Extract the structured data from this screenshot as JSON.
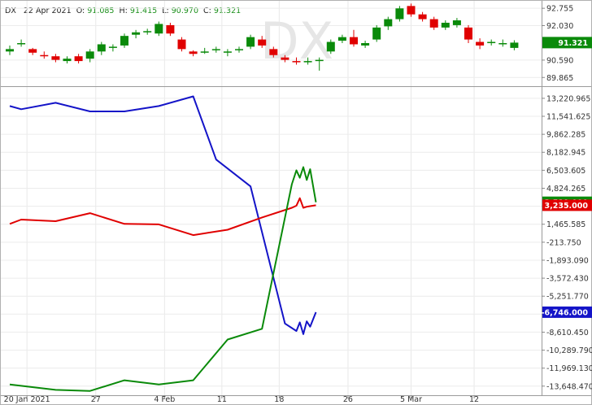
{
  "info": {
    "symbol": "DX",
    "date": "22 Apr 2021",
    "open_label": "O:",
    "open": "91.085",
    "high_label": "H:",
    "high": "91.415",
    "low_label": "L:",
    "low": "90.970",
    "close_label": "C:",
    "close": "91.321"
  },
  "watermark": "DX",
  "chart_data": [
    {
      "type": "candlestick",
      "title": "DX",
      "ylim": [
        89.5,
        93.1
      ],
      "y_ticks": [
        "92.755",
        "92.030",
        "90.590",
        "89.865"
      ],
      "last_value_label": "91.321",
      "colors": {
        "up": "#0a8a0a",
        "down": "#e00000",
        "last_badge": "#0a8a0a"
      },
      "candles": [
        [
          0,
          90.95,
          91.05,
          90.8,
          91.2
        ],
        [
          1,
          91.3,
          91.3,
          91.15,
          91.45
        ],
        [
          2,
          91.05,
          90.9,
          90.8,
          91.1
        ],
        [
          3,
          90.8,
          90.75,
          90.65,
          90.95
        ],
        [
          4,
          90.75,
          90.6,
          90.5,
          90.85
        ],
        [
          5,
          90.55,
          90.65,
          90.45,
          90.75
        ],
        [
          6,
          90.75,
          90.55,
          90.45,
          90.85
        ],
        [
          7,
          90.65,
          90.95,
          90.5,
          91.05
        ],
        [
          8,
          90.95,
          91.25,
          90.8,
          91.35
        ],
        [
          9,
          91.1,
          91.15,
          90.95,
          91.25
        ],
        [
          10,
          91.2,
          91.6,
          91.1,
          91.7
        ],
        [
          11,
          91.65,
          91.75,
          91.5,
          91.85
        ],
        [
          12,
          91.75,
          91.8,
          91.65,
          91.9
        ],
        [
          13,
          91.7,
          92.1,
          91.6,
          92.2
        ],
        [
          14,
          92.05,
          91.7,
          91.6,
          92.15
        ],
        [
          15,
          91.45,
          91.05,
          90.95,
          91.55
        ],
        [
          16,
          90.95,
          90.85,
          90.75,
          91.0
        ],
        [
          17,
          90.95,
          90.95,
          90.85,
          91.1
        ],
        [
          18,
          91.05,
          91.05,
          90.9,
          91.15
        ],
        [
          19,
          90.95,
          90.95,
          90.75,
          91.05
        ],
        [
          20,
          91.05,
          91.05,
          90.9,
          91.15
        ],
        [
          21,
          91.15,
          91.55,
          91.05,
          91.65
        ],
        [
          22,
          91.45,
          91.2,
          91.1,
          91.6
        ],
        [
          23,
          91.05,
          90.8,
          90.7,
          91.15
        ],
        [
          24,
          90.7,
          90.6,
          90.5,
          90.8
        ],
        [
          25,
          90.55,
          90.5,
          90.4,
          90.7
        ],
        [
          26,
          90.5,
          90.55,
          90.4,
          90.7
        ],
        [
          27,
          90.6,
          90.6,
          90.15,
          90.7
        ],
        [
          28,
          90.95,
          91.35,
          90.85,
          91.45
        ],
        [
          29,
          91.4,
          91.55,
          91.3,
          91.65
        ],
        [
          30,
          91.55,
          91.25,
          91.15,
          91.85
        ],
        [
          31,
          91.2,
          91.3,
          91.1,
          91.4
        ],
        [
          32,
          91.45,
          91.95,
          91.35,
          92.05
        ],
        [
          33,
          92.0,
          92.3,
          91.85,
          92.4
        ],
        [
          34,
          92.3,
          92.75,
          92.2,
          92.85
        ],
        [
          35,
          92.85,
          92.5,
          92.4,
          92.95
        ],
        [
          36,
          92.5,
          92.3,
          92.2,
          92.6
        ],
        [
          37,
          92.3,
          91.95,
          91.85,
          92.4
        ],
        [
          38,
          91.95,
          92.15,
          91.85,
          92.25
        ],
        [
          39,
          92.05,
          92.25,
          91.95,
          92.35
        ],
        [
          40,
          91.95,
          91.45,
          91.3,
          92.05
        ],
        [
          41,
          91.35,
          91.2,
          91.05,
          91.5
        ],
        [
          42,
          91.3,
          91.35,
          91.2,
          91.45
        ],
        [
          43,
          91.3,
          91.3,
          91.15,
          91.45
        ],
        [
          44,
          91.1,
          91.32,
          91.0,
          91.42
        ]
      ]
    },
    {
      "type": "line",
      "ylim": [
        -14500,
        14200
      ],
      "y_ticks": [
        "13,220.965",
        "11,541.625",
        "9,862.285",
        "8,182.945",
        "6,503.605",
        "4,824.265",
        "3,144.925",
        "1,465.585",
        "-213.750",
        "-1,893.090",
        "-3,572.430",
        "-5,251.770",
        "-6,931.110",
        "-8,610.450",
        "-10,289.790",
        "-11,969.130",
        "-13,648.470"
      ],
      "x_ticks": [
        "20 Jan 2021",
        "27",
        "4 Feb",
        "11",
        "18",
        "26",
        "5 Mar",
        "12"
      ],
      "badges": [
        {
          "label": "3,235.000",
          "color": "#e00000",
          "y": 3235
        },
        {
          "label": "3,519.000",
          "color": "#0a8a0a",
          "y": 3519
        },
        {
          "label": "-6,746.000",
          "color": "#1414c8",
          "y": -6746
        }
      ],
      "series": [
        {
          "color": "#1414c8",
          "x": [
            0,
            1,
            4,
            7,
            10,
            13,
            16,
            18,
            21,
            24,
            25,
            25.3,
            25.6,
            25.9,
            26.2,
            26.7
          ],
          "y": [
            12500,
            12200,
            12800,
            12000,
            12000,
            12500,
            13400,
            7500,
            5000,
            -7800,
            -8500,
            -7700,
            -8800,
            -7600,
            -8100,
            -6746
          ]
        },
        {
          "color": "#e00000",
          "x": [
            0,
            1,
            4,
            7,
            10,
            13,
            16,
            19,
            22,
            24.6,
            25,
            25.3,
            25.6,
            25.9,
            26.2,
            26.7
          ],
          "y": [
            1500,
            1900,
            1750,
            2500,
            1500,
            1450,
            450,
            950,
            2100,
            3000,
            3200,
            3900,
            3000,
            3100,
            3150,
            3235
          ]
        },
        {
          "color": "#0a8a0a",
          "x": [
            0,
            4,
            7,
            10,
            13,
            16,
            19,
            22,
            24.6,
            25,
            25.3,
            25.6,
            25.9,
            26.2,
            26.7
          ],
          "y": [
            -13500,
            -14000,
            -14100,
            -13100,
            -13500,
            -13100,
            -9300,
            -8300,
            5200,
            6500,
            5800,
            6800,
            5600,
            6600,
            3519
          ]
        }
      ]
    }
  ]
}
